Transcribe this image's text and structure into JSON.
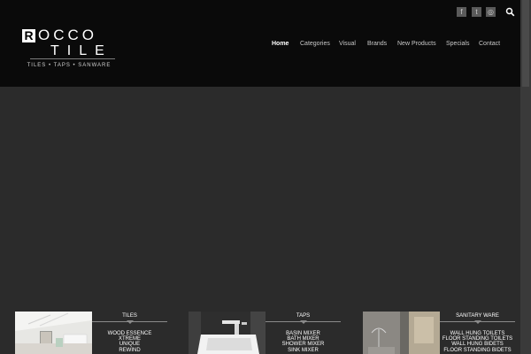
{
  "header": {
    "logo": {
      "letter": "R",
      "rest": "OCCO",
      "line2": "TILE",
      "tagline": "TILES • TAPS • SANWARE"
    },
    "social": [
      {
        "name": "facebook-icon",
        "glyph": "f"
      },
      {
        "name": "twitter-icon",
        "glyph": "t"
      },
      {
        "name": "instagram-icon",
        "glyph": "◎"
      }
    ],
    "nav": [
      "Home",
      "Categories",
      "Visual",
      "Brands",
      "New Products",
      "Specials",
      "Contact"
    ],
    "active_nav": "Home"
  },
  "cards": [
    {
      "title": "TILES",
      "items": [
        "WOOD ESSENCE",
        "XTREME",
        "UNIQUE",
        "REWIND"
      ]
    },
    {
      "title": "TAPS",
      "items": [
        "BASIN MIXER",
        "BATH MIXER",
        "SHOWER MIXER",
        "SINK MIXER"
      ]
    },
    {
      "title": "SANITARY WARE",
      "items": [
        "WALL HUNG TOILETS",
        "FLOOR STANDING TOILETS",
        "WALL HUNG BIDETS",
        "FLOOR STANDING BIDETS"
      ]
    }
  ],
  "colors": {
    "header_bg": "#0a0a0a",
    "page_bg": "#2b2b2b",
    "text": "#ffffff"
  }
}
